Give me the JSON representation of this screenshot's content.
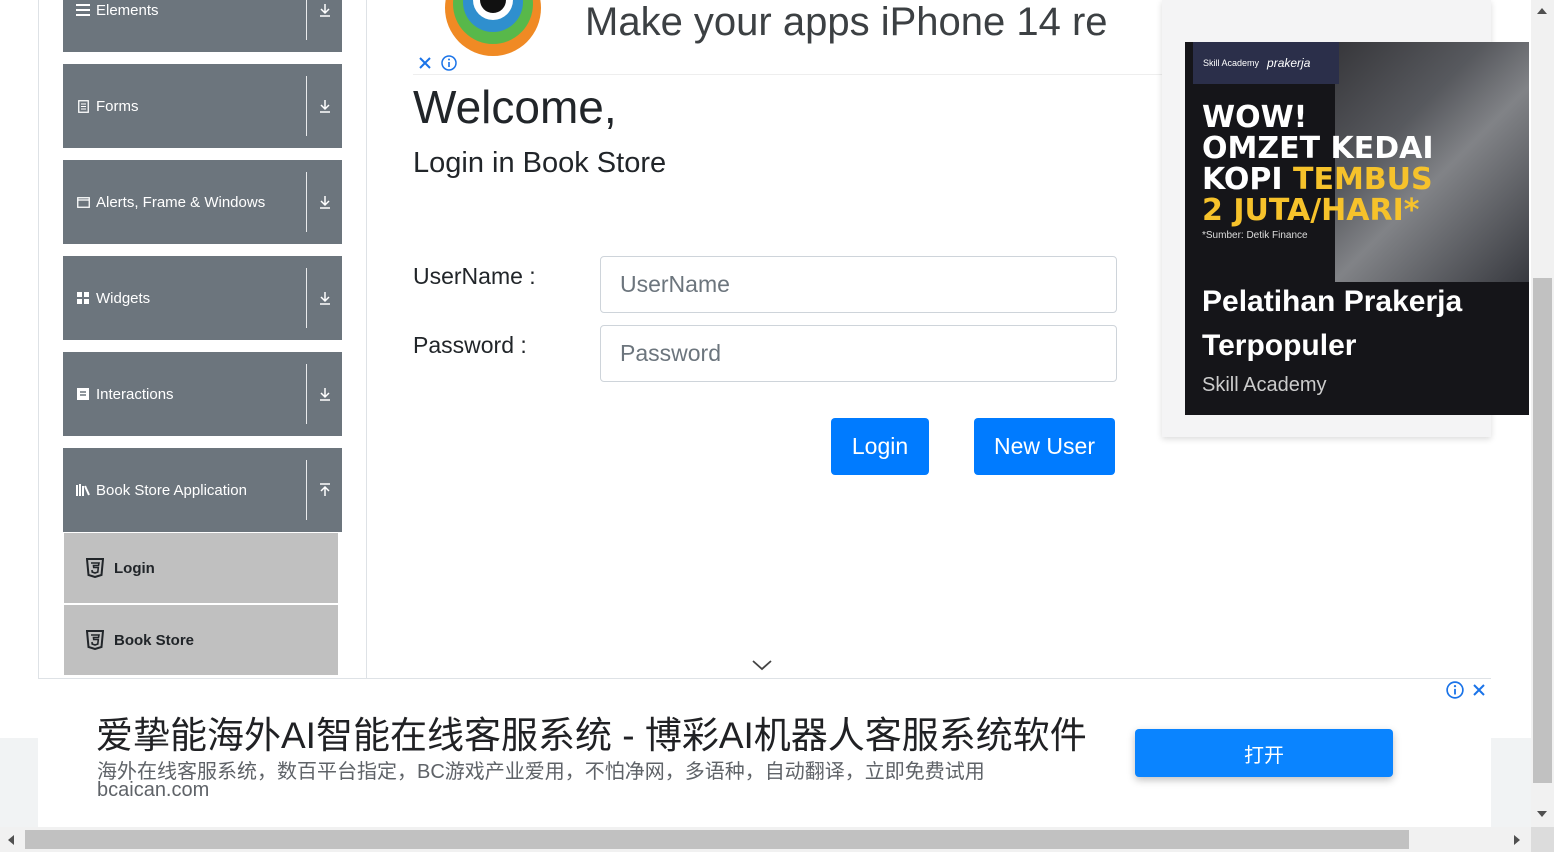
{
  "sidebar": {
    "groups": [
      {
        "label": "Elements",
        "icon": "list-icon"
      },
      {
        "label": "Forms",
        "icon": "form-icon"
      },
      {
        "label": "Alerts, Frame & Windows",
        "icon": "window-icon"
      },
      {
        "label": "Widgets",
        "icon": "grid-icon"
      },
      {
        "label": "Interactions",
        "icon": "interaction-icon"
      },
      {
        "label": "Book Store Application",
        "icon": "library-icon"
      }
    ],
    "book_store_items": [
      {
        "label": "Login",
        "icon": "html5-icon"
      },
      {
        "label": "Book Store",
        "icon": "html5-icon"
      }
    ]
  },
  "top_ad": {
    "text": "Make your apps iPhone 14 re"
  },
  "main": {
    "welcome": "Welcome,",
    "subtitle": "Login in Book Store",
    "username_label": "UserName :",
    "username_placeholder": "UserName",
    "password_label": "Password :",
    "password_placeholder": "Password",
    "login_button": "Login",
    "new_user_button": "New User"
  },
  "right_ad": {
    "brand_1": "Skill Academy",
    "brand_2": "prakerja",
    "line1": "WOW!",
    "line2": "OMZET KEDAI",
    "line3a": "KOPI ",
    "line3b": "TEMBUS",
    "line4": "2 JUTA/HARI*",
    "source": "*Sumber: Detik Finance",
    "title": "Pelatihan Prakerja Terpopuler",
    "org": "Skill Academy"
  },
  "bottom_ad": {
    "headline": "爱挚能海外AI智能在线客服系统 - 博彩AI机器人客服系统软件",
    "description": "海外在线客服系统，数百平台指定，BC游戏产业爱用，不怕净网，多语种，自动翻译，立即免费试用",
    "domain": "bcaican.com",
    "button": "打开"
  },
  "colors": {
    "sidebar_group": "#6c757d",
    "sidebar_sub": "#c0c0c0",
    "primary": "#007bff",
    "ad_yellow": "#f6c22b"
  }
}
